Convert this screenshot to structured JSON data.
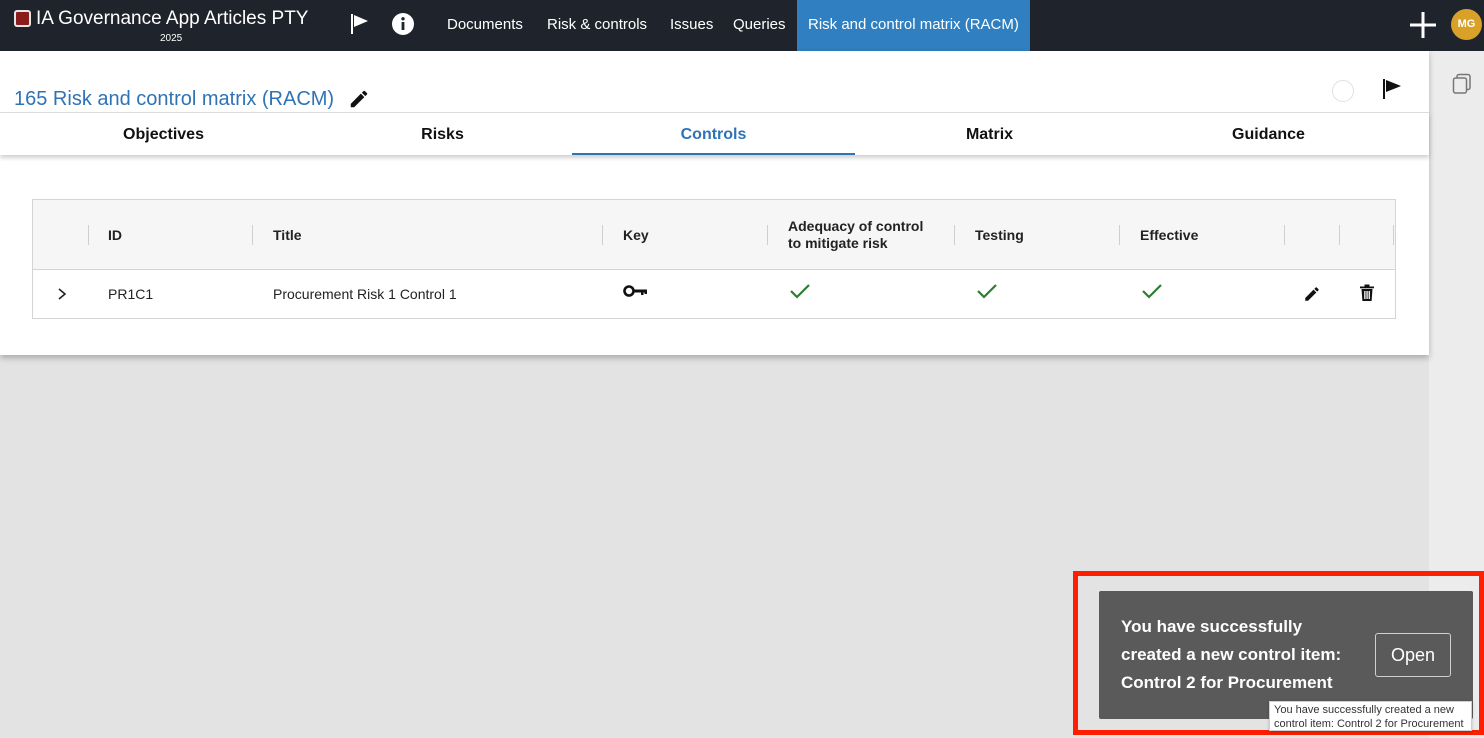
{
  "header": {
    "app_title": "IA Governance App Articles PTY",
    "app_year": "2025",
    "nav": [
      {
        "label": "Documents"
      },
      {
        "label": "Risk & controls"
      },
      {
        "label": "Issues"
      },
      {
        "label": "Queries"
      },
      {
        "label": "Risk and control matrix (RACM)"
      }
    ],
    "active_nav": "Risk and control matrix (RACM)",
    "user_initials": "MG"
  },
  "page": {
    "title": "165 Risk and control matrix (RACM)"
  },
  "tabs": [
    {
      "label": "Objectives"
    },
    {
      "label": "Risks"
    },
    {
      "label": "Controls"
    },
    {
      "label": "Matrix"
    },
    {
      "label": "Guidance"
    }
  ],
  "active_tab": "Controls",
  "table": {
    "columns": {
      "id": "ID",
      "title": "Title",
      "key": "Key",
      "adequacy_line1": "Adequacy of control",
      "adequacy_line2": "to mitigate risk",
      "testing": "Testing",
      "effective": "Effective"
    },
    "rows": [
      {
        "id": "PR1C1",
        "title": "Procurement Risk 1 Control 1",
        "key": true,
        "adequacy": true,
        "testing": true,
        "effective": true
      }
    ]
  },
  "toast": {
    "message": "You have successfully created a new control item: Control 2 for Procurement",
    "action_label": "Open",
    "tooltip": "You have successfully created a new control item: Control 2 for Procurement"
  },
  "colors": {
    "topbar": "#1f232b",
    "accent": "#2f73b5",
    "active_nav": "#2f7fc1",
    "check": "#2e7d32",
    "avatar": "#d9a128",
    "toast_bg": "#5a5a5a",
    "highlight": "#ff1e00"
  }
}
